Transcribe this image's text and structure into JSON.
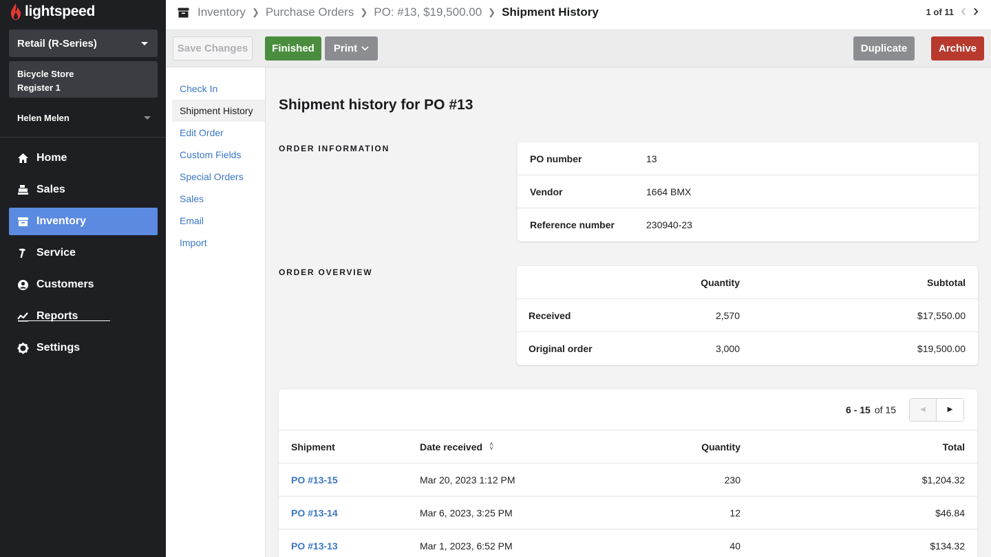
{
  "brand": {
    "name": "lightspeed",
    "accent": "#e03a2f"
  },
  "sidebar": {
    "store_select": "Retail (R-Series)",
    "store_name": "Bicycle Store",
    "register_name": "Register 1",
    "user_name": "Helen Melen",
    "items": [
      {
        "label": "Home",
        "icon": "home-icon"
      },
      {
        "label": "Sales",
        "icon": "register-icon"
      },
      {
        "label": "Inventory",
        "icon": "inventory-box-icon",
        "active": true
      },
      {
        "label": "Service",
        "icon": "hammer-icon"
      },
      {
        "label": "Customers",
        "icon": "person-icon"
      },
      {
        "label": "Reports",
        "icon": "chart-line-icon"
      },
      {
        "label": "Settings",
        "icon": "gear-icon"
      }
    ],
    "active_color": "#5b8ae0"
  },
  "header": {
    "breadcrumbs": [
      "Inventory",
      "Purchase Orders",
      "PO: #13, $19,500.00"
    ],
    "current": "Shipment History",
    "pager": "1 of 11"
  },
  "toolbar": {
    "save_label": "Save Changes",
    "finished_label": "Finished",
    "print_label": "Print",
    "duplicate_label": "Duplicate",
    "archive_label": "Archive"
  },
  "subnav": {
    "items": [
      "Check In",
      "Shipment History",
      "Edit Order",
      "Custom Fields",
      "Special Orders",
      "Sales",
      "Email",
      "Import"
    ],
    "active": "Shipment History"
  },
  "main": {
    "title": "Shipment history for PO #13",
    "order_info": {
      "label": "ORDER INFORMATION",
      "rows": [
        {
          "key": "PO number",
          "value": "13"
        },
        {
          "key": "Vendor",
          "value": "1664 BMX"
        },
        {
          "key": "Reference number",
          "value": "230940-23"
        }
      ]
    },
    "order_overview": {
      "label": "ORDER OVERVIEW",
      "headers": {
        "quantity": "Quantity",
        "subtotal": "Subtotal"
      },
      "rows": [
        {
          "label": "Received",
          "quantity": "2,570",
          "subtotal": "$17,550.00"
        },
        {
          "label": "Original order",
          "quantity": "3,000",
          "subtotal": "$19,500.00"
        }
      ]
    },
    "shipments": {
      "range": "6 - 15",
      "of_total": "of 15",
      "headers": {
        "shipment": "Shipment",
        "date": "Date received",
        "quantity": "Quantity",
        "total": "Total"
      },
      "rows": [
        {
          "shipment": "PO #13-15",
          "date": "Mar 20, 2023 1:12 PM",
          "quantity": "230",
          "total": "$1,204.32"
        },
        {
          "shipment": "PO #13-14",
          "date": "Mar 6, 2023, 3:25 PM",
          "quantity": "12",
          "total": "$46.84"
        },
        {
          "shipment": "PO #13-13",
          "date": "Mar 1, 2023, 6:52 PM",
          "quantity": "40",
          "total": "$134.32"
        }
      ]
    }
  }
}
